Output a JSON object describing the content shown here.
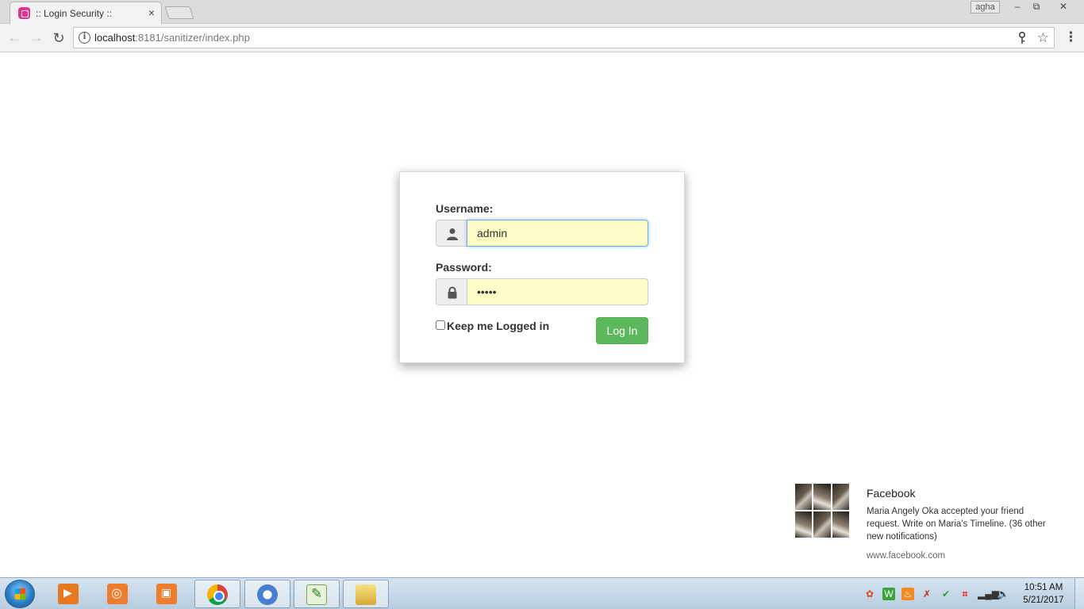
{
  "browser": {
    "tab_title": ":: Login Security ::",
    "tab_close": "×",
    "user_badge": "agha",
    "window_minimize": "–",
    "window_restore": "⧉",
    "window_close": "✕",
    "nav_back": "←",
    "nav_forward": "→",
    "nav_reload": "↻",
    "url_host": "localhost",
    "url_path": ":8181/sanitizer/index.php",
    "info_glyph": "i",
    "key_glyph": "⚲",
    "star_glyph": "☆",
    "menu_glyph": "⋮"
  },
  "login": {
    "username_label": "Username:",
    "username_value": "admin",
    "password_label": "Password:",
    "password_value": "admin",
    "remember_label": "Keep me Logged in",
    "remember_checked": false,
    "submit_label": "Log In"
  },
  "notification": {
    "title": "Facebook",
    "body": "Maria Angely Oka accepted your friend request. Write on Maria's Timeline. (36 other new notifications)",
    "source": "www.facebook.com"
  },
  "taskbar": {
    "clock_time": "10:51 AM",
    "clock_date": "5/21/2017",
    "tray_icons": [
      "colors-icon",
      "wamp-icon",
      "java-icon",
      "network-x-icon",
      "security-check-icon",
      "crop-tool-icon",
      "signal-bars-icon",
      "speaker-icon"
    ]
  },
  "colors": {
    "login_button": "#5cb85c",
    "autofill_bg": "#fdfdc8",
    "focus_ring": "#66afe9",
    "favicon": "#e8318b"
  }
}
